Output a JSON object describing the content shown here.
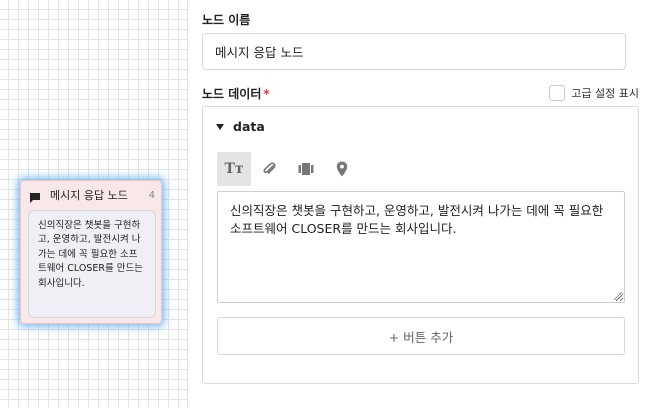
{
  "canvas": {
    "node": {
      "title": "메시지 응답 노드",
      "count": "4",
      "body": "신의직장은 챗봇을 구현하고, 운영하고, 발전시켜 나가는 데에 꼭 필요한 소프트웨어 CLOSER를 만드는 회사입니다.",
      "icon": "chat-bubble-icon",
      "border_color": "#f0c4cb",
      "glow_color": "#5aaaf0"
    }
  },
  "panel": {
    "node_name_label": "노드 이름",
    "node_name_value": "메시지 응답 노드",
    "node_data_label": "노드 데이터",
    "required_mark": "*",
    "advanced_label": "고급 설정 표시",
    "data_section_label": "data",
    "toolbar": [
      {
        "icon": "text-format-icon",
        "glyph": "Tт",
        "active": true
      },
      {
        "icon": "attachment-icon",
        "active": false
      },
      {
        "icon": "carousel-icon",
        "active": false
      },
      {
        "icon": "location-pin-icon",
        "active": false
      }
    ],
    "message_text": "신의직장은 챗봇을 구현하고, 운영하고, 발전시켜 나가는 데에 꼭 필요한 소프트웨어 CLOSER를 만드는 회사입니다.",
    "add_button_label": "+ 버튼 추가"
  }
}
